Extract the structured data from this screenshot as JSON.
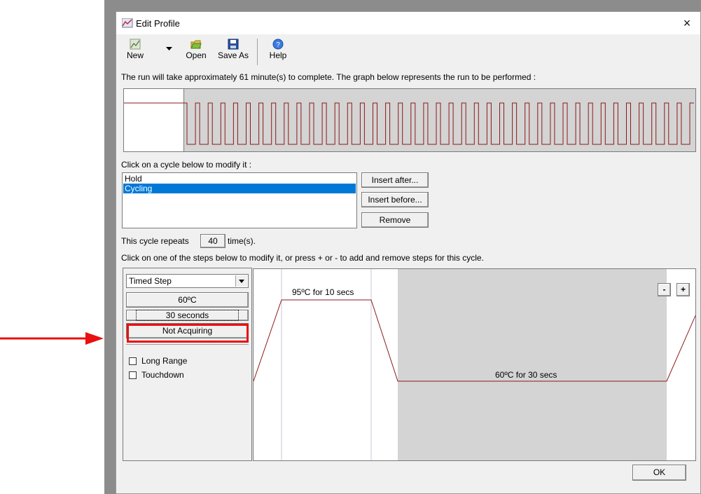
{
  "window": {
    "title": "Edit Profile",
    "close_label": "×"
  },
  "toolbar": {
    "new_label": "New",
    "open_label": "Open",
    "save_as_label": "Save As",
    "help_label": "Help"
  },
  "run_info": "The run will take approximately 61 minute(s) to complete. The graph below represents the run to be performed :",
  "cycles": {
    "prompt": "Click on a cycle below to modify it :",
    "items": [
      {
        "label": "Hold",
        "selected": false
      },
      {
        "label": "Cycling",
        "selected": true
      }
    ],
    "insert_after_label": "Insert after...",
    "insert_before_label": "Insert before...",
    "remove_label": "Remove"
  },
  "repeat": {
    "prefix": "This cycle repeats",
    "count": "40",
    "suffix": "time(s)."
  },
  "steps_prompt": "Click on one of the steps below to modify it, or press + or - to add and remove steps for this cycle.",
  "step_editor": {
    "type_value": "Timed Step",
    "temperature": "60ºC",
    "duration": "30 seconds",
    "acquire": "Not Acquiring",
    "long_range_label": "Long Range",
    "touchdown_label": "Touchdown"
  },
  "step_graph": {
    "step1_label": "95ºC for 10 secs",
    "step2_label": "60ºC for 30 secs",
    "minus_label": "-",
    "plus_label": "+"
  },
  "ok_label": "OK",
  "colors": {
    "trace": "#8b1a1a",
    "selection": "#0078d7",
    "highlight_box": "#e81010",
    "arrow": "#e81010",
    "step_shade": "#d4d4d4"
  }
}
